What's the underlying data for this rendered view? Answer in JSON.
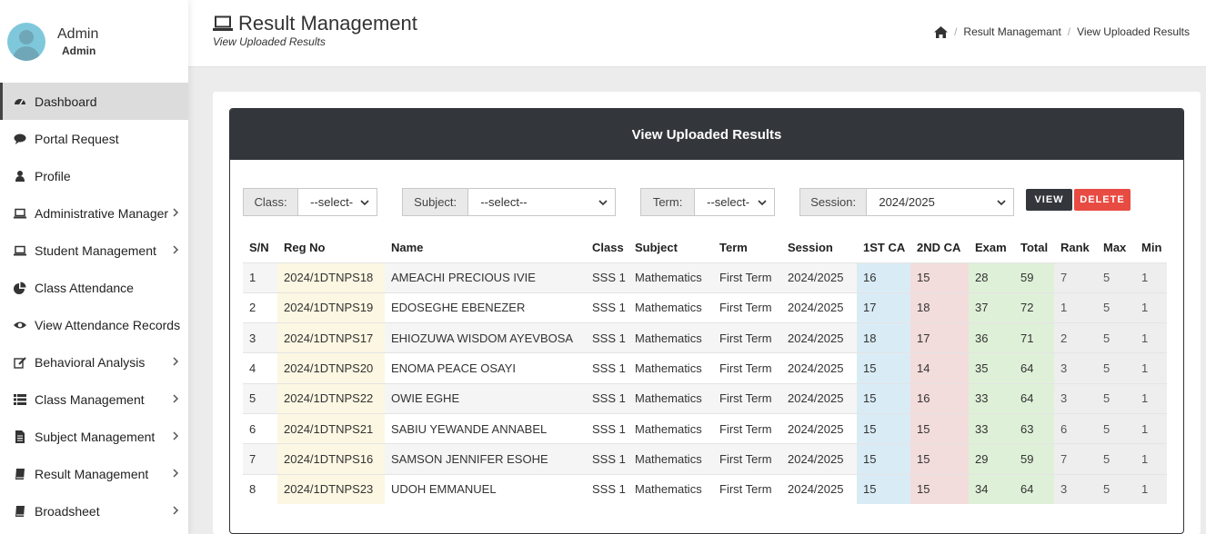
{
  "user": {
    "name": "Admin",
    "role": "Admin"
  },
  "sidebar": {
    "items": [
      {
        "label": "Dashboard",
        "icon": "dashboard-icon",
        "active": true,
        "submenu": false
      },
      {
        "label": "Portal Request",
        "icon": "comment-icon",
        "active": false,
        "submenu": false
      },
      {
        "label": "Profile",
        "icon": "user-icon",
        "active": false,
        "submenu": false
      },
      {
        "label": "Administrative Manager",
        "icon": "laptop-icon",
        "active": false,
        "submenu": true
      },
      {
        "label": "Student Management",
        "icon": "laptop-icon",
        "active": false,
        "submenu": true
      },
      {
        "label": "Class Attendance",
        "icon": "pie-chart-icon",
        "active": false,
        "submenu": false
      },
      {
        "label": "View Attendance Records",
        "icon": "eye-icon",
        "active": false,
        "submenu": false
      },
      {
        "label": "Behavioral Analysis",
        "icon": "edit-icon",
        "active": false,
        "submenu": true
      },
      {
        "label": "Class Management",
        "icon": "list-icon",
        "active": false,
        "submenu": true
      },
      {
        "label": "Subject Management",
        "icon": "file-icon",
        "active": false,
        "submenu": true
      },
      {
        "label": "Result Management",
        "icon": "book-icon",
        "active": false,
        "submenu": true
      },
      {
        "label": "Broadsheet",
        "icon": "book-icon",
        "active": false,
        "submenu": true
      }
    ]
  },
  "header": {
    "title": "Result Management",
    "subtitle": "View Uploaded Results",
    "breadcrumb": [
      "Result Managemant",
      "View Uploaded Results"
    ]
  },
  "card": {
    "title": "View Uploaded Results"
  },
  "filters": {
    "class": {
      "label": "Class:",
      "value": "--select-"
    },
    "subject": {
      "label": "Subject:",
      "value": "--select--"
    },
    "term": {
      "label": "Term:",
      "value": "--select-"
    },
    "session": {
      "label": "Session:",
      "value": "2024/2025"
    },
    "view_label": "VIEW",
    "delete_label": "DELETE"
  },
  "table": {
    "columns": [
      "S/N",
      "Reg No",
      "Name",
      "Class",
      "Subject",
      "Term",
      "Session",
      "1ST CA",
      "2ND CA",
      "Exam",
      "Total",
      "Rank",
      "Max",
      "Min"
    ],
    "rows": [
      [
        "1",
        "2024/1DTNPS18",
        "AMEACHI PRECIOUS IVIE",
        "SSS 1",
        "Mathematics",
        "First Term",
        "2024/2025",
        "16",
        "15",
        "28",
        "59",
        "7",
        "5",
        "1"
      ],
      [
        "2",
        "2024/1DTNPS19",
        "EDOSEGHE EBENEZER",
        "SSS 1",
        "Mathematics",
        "First Term",
        "2024/2025",
        "17",
        "18",
        "37",
        "72",
        "1",
        "5",
        "1"
      ],
      [
        "3",
        "2024/1DTNPS17",
        "EHIOZUWA WISDOM AYEVBOSA",
        "SSS 1",
        "Mathematics",
        "First Term",
        "2024/2025",
        "18",
        "17",
        "36",
        "71",
        "2",
        "5",
        "1"
      ],
      [
        "4",
        "2024/1DTNPS20",
        "ENOMA PEACE OSAYI",
        "SSS 1",
        "Mathematics",
        "First Term",
        "2024/2025",
        "15",
        "14",
        "35",
        "64",
        "3",
        "5",
        "1"
      ],
      [
        "5",
        "2024/1DTNPS22",
        "OWIE EGHE",
        "SSS 1",
        "Mathematics",
        "First Term",
        "2024/2025",
        "15",
        "16",
        "33",
        "64",
        "3",
        "5",
        "1"
      ],
      [
        "6",
        "2024/1DTNPS21",
        "SABIU YEWANDE ANNABEL",
        "SSS 1",
        "Mathematics",
        "First Term",
        "2024/2025",
        "15",
        "15",
        "33",
        "63",
        "6",
        "5",
        "1"
      ],
      [
        "7",
        "2024/1DTNPS16",
        "SAMSON JENNIFER ESOHE",
        "SSS 1",
        "Mathematics",
        "First Term",
        "2024/2025",
        "15",
        "15",
        "29",
        "59",
        "7",
        "5",
        "1"
      ],
      [
        "8",
        "2024/1DTNPS23",
        "UDOH EMMANUEL",
        "SSS 1",
        "Mathematics",
        "First Term",
        "2024/2025",
        "15",
        "15",
        "34",
        "64",
        "3",
        "5",
        "1"
      ]
    ]
  },
  "colors": {
    "dark_header": "#33373c",
    "delete_red": "#e84b42",
    "reg_col": "#fcf7e2",
    "ca1_col": "#d9ecf6",
    "ca2_col": "#f3dcdc",
    "exam_total_col": "#dff0d8"
  }
}
